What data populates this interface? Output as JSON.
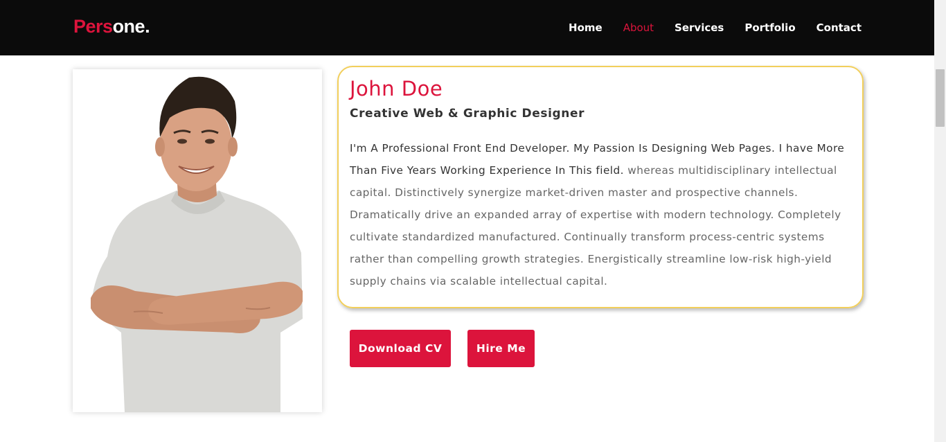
{
  "brand": {
    "part1": "Pers",
    "part2": "one.",
    "accent_color": "#dc143c"
  },
  "nav": {
    "items": [
      {
        "label": "Home",
        "active": false
      },
      {
        "label": "About",
        "active": true
      },
      {
        "label": "Services",
        "active": false
      },
      {
        "label": "Portfolio",
        "active": false
      },
      {
        "label": "Contact",
        "active": false
      }
    ]
  },
  "profile": {
    "name": "John Doe",
    "role": "Creative Web & Graphic Designer",
    "bio_strong": "I'm A Professional Front End Developer. My Passion Is Designing Web Pages. I have More Than Five Years Working Experience In This field.",
    "bio_rest": " whereas multidisciplinary intellectual capital. Distinctively synergize market-driven master and prospective channels. Dramatically drive an expanded array of expertise with modern technology. Completely cultivate standardized manufactured. Continually transform process-centric systems rather than compelling growth strategies. Energistically streamline low-risk high-yield supply chains via scalable intellectual capital."
  },
  "actions": {
    "download_cv": "Download CV",
    "hire_me": "Hire Me"
  },
  "colors": {
    "navbar_bg": "#0b0b0b",
    "accent": "#dc143c",
    "box_border": "#f2cf5b"
  }
}
